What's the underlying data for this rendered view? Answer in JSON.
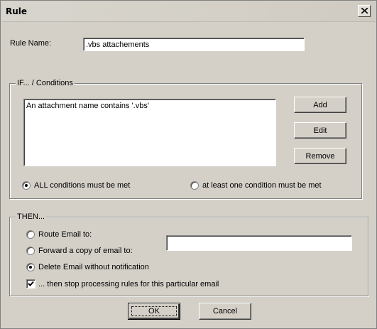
{
  "window": {
    "title": "Rule",
    "close_icon": "close-icon"
  },
  "rule_name": {
    "label": "Rule Name:",
    "value": ".vbs attachements"
  },
  "conditions": {
    "legend": "IF... / Conditions",
    "items": [
      "An attachment name contains '.vbs'"
    ],
    "buttons": {
      "add": "Add",
      "edit": "Edit",
      "remove": "Remove"
    },
    "match": {
      "all_label": "ALL conditions must be met",
      "any_label": "at least one condition must be met",
      "selected": "all"
    }
  },
  "then": {
    "legend": "THEN...",
    "route_label": "Route Email to:",
    "forward_label": "Forward a copy of email to:",
    "delete_label": "Delete Email without notification",
    "selected": "delete",
    "forward_value": "",
    "stop_label": "... then stop processing rules for this particular email",
    "stop_checked": true
  },
  "footer": {
    "ok": "OK",
    "cancel": "Cancel"
  }
}
